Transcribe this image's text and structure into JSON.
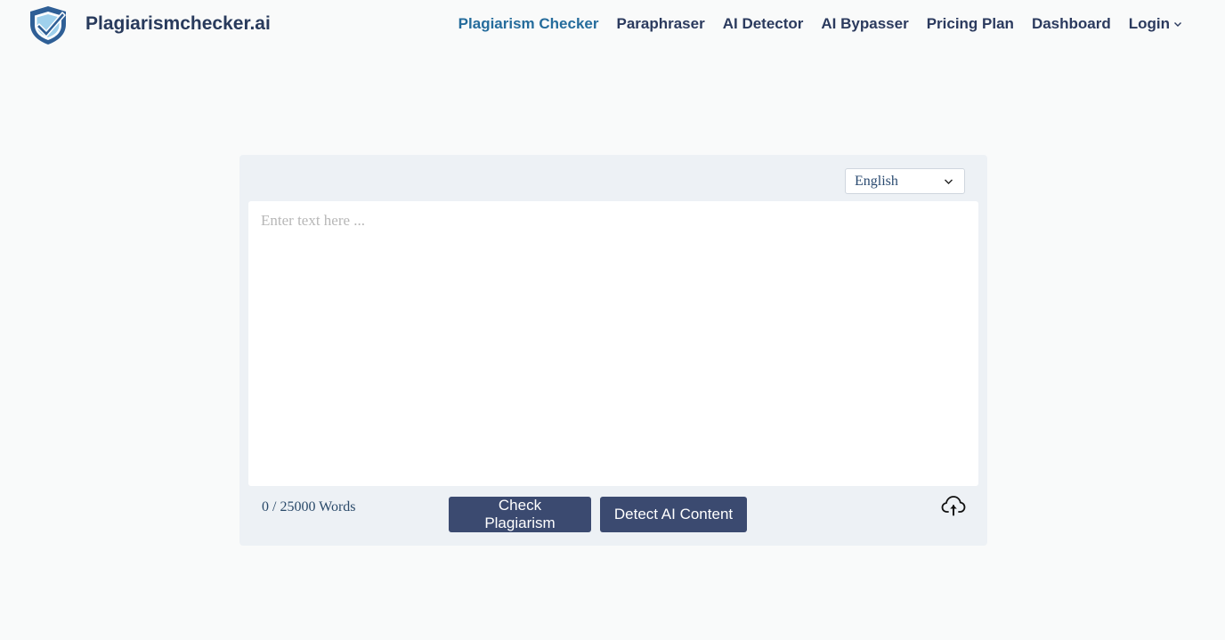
{
  "brand": {
    "name": "Plagiarismchecker.ai",
    "logo_icon": "shield-check-icon"
  },
  "nav": {
    "items": [
      {
        "label": "Plagiarism Checker",
        "active": true
      },
      {
        "label": "Paraphraser",
        "active": false
      },
      {
        "label": "AI Detector",
        "active": false
      },
      {
        "label": "AI Bypasser",
        "active": false
      },
      {
        "label": "Pricing Plan",
        "active": false
      },
      {
        "label": "Dashboard",
        "active": false
      },
      {
        "label": "Login",
        "active": false,
        "icon": "chevron-down-icon"
      }
    ]
  },
  "editor": {
    "language": "English",
    "placeholder": "Enter text here ...",
    "value": "",
    "word_count": "0 / 25000 Words",
    "upload_icon": "cloud-upload-icon"
  },
  "actions": {
    "check_label": "Check Plagiarism",
    "detect_label": "Detect AI Content"
  },
  "colors": {
    "brand_text": "#283a5c",
    "active_nav": "#256c9c",
    "button_bg": "#3b4a70",
    "card_bg": "#edf1f5",
    "page_bg": "#f9fafa"
  }
}
